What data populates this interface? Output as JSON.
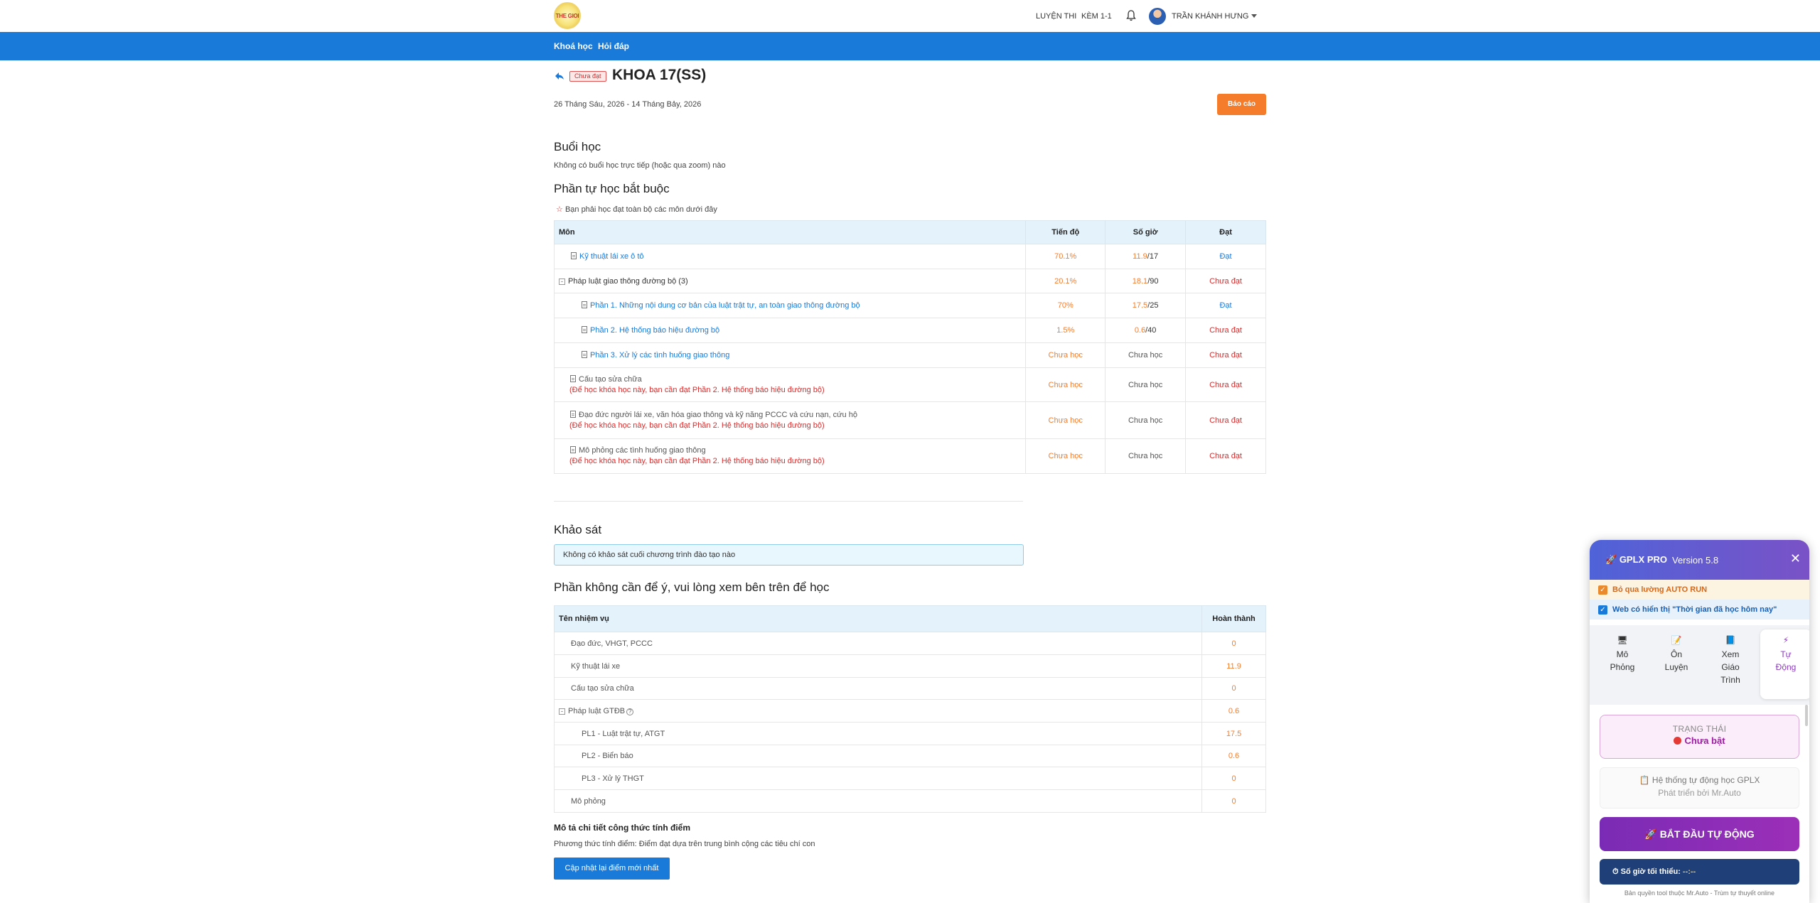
{
  "header": {
    "logo_text": "THE GIOI",
    "nav": {
      "luyen_thi": "LUYỆN THI",
      "kem": "KÈM 1-1"
    },
    "user_name": "TRẦN KHÁNH HƯNG"
  },
  "subnav": {
    "courses": "Khoá học",
    "qa": "Hỏi đáp"
  },
  "course": {
    "status_badge": "Chưa đạt",
    "title": "KHOA 17(SS)",
    "date_range": "26 Tháng Sáu, 2026 - 14 Tháng Bảy, 2026",
    "report_button": "Báo cáo"
  },
  "sessions": {
    "heading": "Buổi học",
    "empty_text": "Không có buổi học trực tiếp (hoặc qua zoom) nào"
  },
  "self_study": {
    "heading": "Phần tự học bắt buộc",
    "note_icon": "☆",
    "note": "Bạn phải học đạt toàn bộ các môn dưới đây",
    "columns": {
      "subject": "Môn",
      "progress": "Tiến độ",
      "hours": "Số giờ",
      "pass": "Đạt"
    },
    "rows": [
      {
        "name": "Kỹ thuật lái xe ô tô",
        "progress": "70.1%",
        "hours_done": "11.9",
        "hours_total": "/17",
        "pass": "Đạt"
      },
      {
        "name": "Pháp luật giao thông đường bộ",
        "count": "(3)",
        "progress": "20.1%",
        "hours_done": "18.1",
        "hours_total": "/90",
        "pass": "Chưa đạt"
      },
      {
        "name": "Phần 1. Những nội dung cơ bản của luật trật tự, an toàn giao thông đường bộ",
        "progress": "70%",
        "hours_done": "17.5",
        "hours_total": "/25",
        "pass": "Đạt"
      },
      {
        "name": "Phần 2. Hệ thống báo hiệu đường bộ",
        "progress": "1.5%",
        "hours_done": "0.6",
        "hours_total": "/40",
        "pass": "Chưa đạt"
      },
      {
        "name": "Phần 3. Xử lý các tình huống giao thông",
        "progress": "Chưa học",
        "hours": "Chưa học",
        "pass": "Chưa đạt"
      },
      {
        "name": "Cấu tạo sửa chữa",
        "note": "(Để học khóa học này, bạn cần đạt Phần 2. Hệ thống báo hiệu đường bộ)",
        "progress": "Chưa học",
        "hours": "Chưa học",
        "pass": "Chưa đạt"
      },
      {
        "name": "Đạo đức người lái xe, văn hóa giao thông và kỹ năng PCCC và cứu nạn, cứu hộ",
        "note": "(Để học khóa học này, bạn cần đạt Phần 2. Hệ thống báo hiệu đường bộ)",
        "progress": "Chưa học",
        "hours": "Chưa học",
        "pass": "Chưa đạt"
      },
      {
        "name": "Mô phỏng các tình huống giao thông",
        "note": "(Để học khóa học này, bạn cần đạt Phần 2. Hệ thống báo hiệu đường bộ)",
        "progress": "Chưa học",
        "hours": "Chưa học",
        "pass": "Chưa đạt"
      }
    ]
  },
  "survey": {
    "heading": "Khảo sát",
    "empty_text": "Không có khảo sát cuối chương trình đào tạo nào"
  },
  "ignore_section": {
    "heading": "Phần không cần để ý, vui lòng xem bên trên để học",
    "columns": {
      "task": "Tên nhiệm vụ",
      "done": "Hoàn thành"
    },
    "rows": [
      {
        "name": "Đạo đức, VHGT, PCCC",
        "value": "0"
      },
      {
        "name": "Kỹ thuật lái xe",
        "value": "11.9"
      },
      {
        "name": "Cấu tạo sửa chữa",
        "value": "0"
      },
      {
        "name": "Pháp luật GTĐB",
        "value": "0.6"
      },
      {
        "name": "PL1 - Luật trật tự, ATGT",
        "value": "17.5"
      },
      {
        "name": "PL2 - Biển báo",
        "value": "0.6"
      },
      {
        "name": "PL3 - Xử lý THGT",
        "value": "0"
      },
      {
        "name": "Mô phỏng",
        "value": "0"
      }
    ]
  },
  "formula": {
    "heading": "Mô tả chi tiết công thức tính điểm",
    "text": "Phương thức tính điểm: Điểm đạt dựa trên trung bình cộng các tiêu chí con",
    "update_button": "Cập nhật lại điểm mới nhất"
  },
  "widget": {
    "title": "GPLX PRO",
    "version": "Version 5.8",
    "close": "✕",
    "opt_autorun": "Bỏ qua lường AUTO RUN",
    "opt_time": "Web có hiển thị \"Thời gian đã học hôm nay\"",
    "tabs": [
      {
        "icon": "🖥",
        "line1": "Mô",
        "line2": "Phỏng",
        "line3": ""
      },
      {
        "icon": "📝",
        "line1": "Ôn",
        "line2": "Luyện",
        "line3": ""
      },
      {
        "icon": "📘",
        "line1": "Xem",
        "line2": "Giáo",
        "line3": "Trình"
      },
      {
        "icon": "⚡",
        "line1": "Tự",
        "line2": "Động",
        "line3": ""
      }
    ],
    "status_label": "TRẠNG THÁI",
    "status_value": "Chưa bật",
    "info_line1": "Hệ thống tự động học GPLX",
    "info_line2": "Phát triển bởi Mr.Auto",
    "start_button": "BẮT ĐẦU TỰ ĐỘNG",
    "min_hours_label": "Số giờ tối thiểu:",
    "min_hours_value": "--:--",
    "footer": "Bản quyền tool thuộc Mr.Auto - Trùm tự thuyết online"
  },
  "colors": {
    "primary_blue": "#1a7ad9",
    "orange": "#f57c2b",
    "red": "#d32f2f",
    "widget_purple": "#7a2bb5"
  }
}
